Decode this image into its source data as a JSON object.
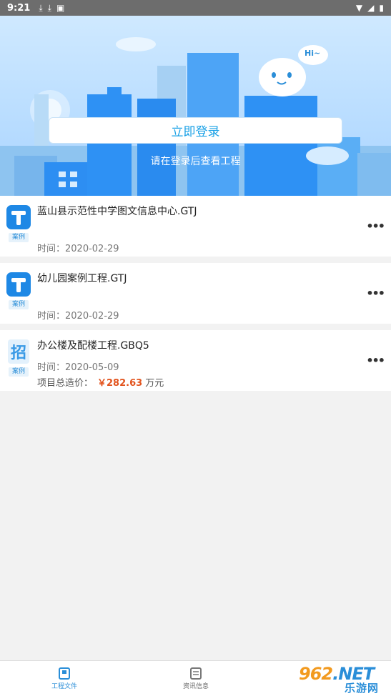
{
  "status_bar": {
    "time": "9:21",
    "icons": [
      "download-icon",
      "download-icon",
      "app-icon"
    ],
    "right_icons": [
      "wifi-icon",
      "signal-icon",
      "battery-icon"
    ]
  },
  "hero": {
    "login_label": "立即登录",
    "hint": "请在登录后查看工程",
    "bubble_text": "Hi~"
  },
  "projects": [
    {
      "title": "蓝山县示范性中学图文信息中心.GTJ",
      "tag": "案例",
      "time_label": "时间：",
      "time": "2020-02-29",
      "icon": "t-app-icon",
      "more": "•••"
    },
    {
      "title": "幼儿园案例工程.GTJ",
      "tag": "案例",
      "time_label": "时间：",
      "time": "2020-02-29",
      "icon": "t-app-icon",
      "more": "•••"
    },
    {
      "title": "办公楼及配楼工程.GBQ5",
      "tag": "案例",
      "time_label": "时间：",
      "time": "2020-05-09",
      "icon": "zhao-doc-icon",
      "price_label": "项目总造价：",
      "price": "￥282.63",
      "price_unit": "万元",
      "more": "•••"
    }
  ],
  "tabs": [
    {
      "label": "工程文件",
      "icon": "project-files-icon",
      "active": true
    },
    {
      "label": "资讯信息",
      "icon": "news-icon",
      "active": false
    }
  ],
  "watermark": {
    "logo_main": "962",
    "logo_net": ".NET",
    "text": "乐游网"
  },
  "colors": {
    "accent": "#2a8ed8",
    "price": "#e2531d",
    "hero_top": "#cfe9ff"
  }
}
